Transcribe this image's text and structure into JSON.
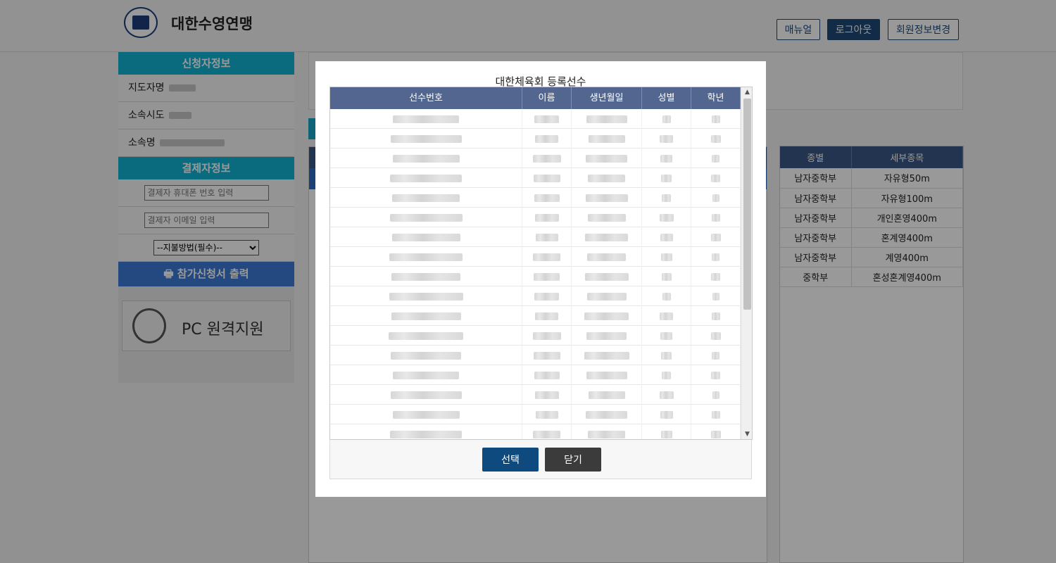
{
  "header": {
    "org_name": "대한수영연맹",
    "manual_label": "매뉴얼",
    "logout_label": "로그아웃",
    "member_edit_label": "회원정보변경"
  },
  "sidebar": {
    "applicant_title": "신청자정보",
    "coach_label": "지도자명",
    "region_label": "소속시도",
    "team_label": "소속명",
    "payer_title": "결제자정보",
    "phone_placeholder": "결제자 휴대폰 번호 입력",
    "email_placeholder": "결제자 이메일 입력",
    "payment_select": "--지불방법(필수)--",
    "print_label": "참가신청서 출력",
    "remote_label": "PC 원격지원"
  },
  "events": {
    "headers": [
      "종별",
      "세부종목"
    ],
    "rows": [
      {
        "division": "남자중학부",
        "event": "자유형50m"
      },
      {
        "division": "남자중학부",
        "event": "자유형100m"
      },
      {
        "division": "남자중학부",
        "event": "개인혼영400m"
      },
      {
        "division": "남자중학부",
        "event": "혼계영400m"
      },
      {
        "division": "남자중학부",
        "event": "계영400m"
      },
      {
        "division": "중학부",
        "event": "혼성혼계영400m"
      }
    ]
  },
  "modal": {
    "title": "대한체육회 등록선수",
    "columns": [
      "선수번호",
      "이름",
      "생년월일",
      "성별",
      "학년"
    ],
    "select_label": "선택",
    "close_label": "닫기"
  }
}
